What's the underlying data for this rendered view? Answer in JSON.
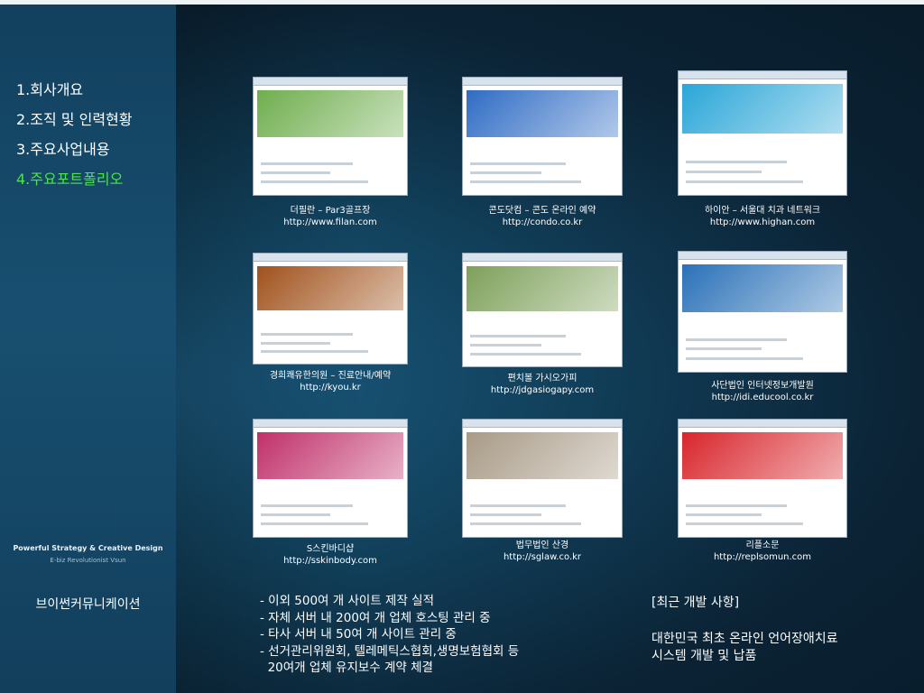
{
  "menu": [
    {
      "label": "1.회사개요"
    },
    {
      "label": "2.조직 및 인력현황"
    },
    {
      "label": "3.주요사업내용"
    },
    {
      "label": "4.주요포트폴리오"
    }
  ],
  "slogan": {
    "line1": "Powerful Strategy & Creative Design",
    "line2": "E-biz Revolutionist Vsun"
  },
  "company_name": "브이썬커뮤니케이션",
  "portfolio": [
    {
      "title": "더필란 – Par3골프장",
      "url": "http://www.filan.com",
      "theme": "#6fae4e"
    },
    {
      "title": "콘도닷컴 – 콘도 온라인 예약",
      "url": "http://condo.co.kr",
      "theme": "#2f6cc4"
    },
    {
      "title": "하이안 – 서울대 치과 네트워크",
      "url": "http://www.highan.com",
      "theme": "#2aa6d8"
    },
    {
      "title": "경희쾌유한의원 – 진료안내/예약",
      "url": "http://kyou.kr",
      "theme": "#a0521c"
    },
    {
      "title": "편치볼 가시오가피",
      "url": "http://jdgasiogapy.com",
      "theme": "#7ea05a"
    },
    {
      "title": "사단법인 인터넷정보개발원",
      "url": "http://idi.educool.co.kr",
      "theme": "#2a71b8"
    },
    {
      "title": "S스킨바디샵",
      "url": "http://sskinbody.com",
      "theme": "#c0306a"
    },
    {
      "title": "법무법인 산경",
      "url": "http://sglaw.co.kr",
      "theme": "#a89a86"
    },
    {
      "title": "리플소문",
      "url": "http://replsomun.com",
      "theme": "#d8262c"
    }
  ],
  "notes": [
    "- 이외 500여 개 사이트 제작 실적",
    "- 자체 서버 내 200여 개 업체 호스팅 관리 중",
    "- 타사 서버 내 50여 개 사이트 관리 중",
    "- 선거관리위원회, 텔레메틱스협회,생명보험협회 등",
    "  20여개 업체 유지보수 계약 체결"
  ],
  "recent": {
    "heading": "[최근 개발 사항]",
    "lines": [
      "대한민국 최초 온라인 언어장애치료",
      "시스템 개발 및 납품"
    ]
  }
}
